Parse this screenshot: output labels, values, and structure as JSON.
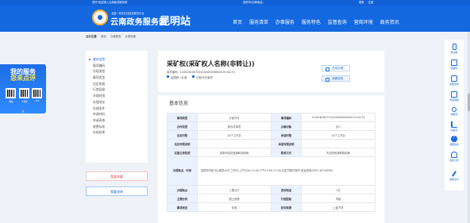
{
  "topbar": {
    "left": "您好!欢迎进入云南政务服务网",
    "center": "昆明市(切换地区)",
    "login": "登录",
    "register": "注册"
  },
  "header": {
    "subtitle": "全国一体化在线政务服务平台",
    "site_name": "云南政务服务网",
    "city": "昆明站",
    "nav": [
      "首页",
      "服务清单",
      "办事服务",
      "服务特色",
      "监督查询",
      "营商环境",
      "政务资讯"
    ]
  },
  "breadcrumb": {
    "label": "当前位置:",
    "items": [
      "首页",
      "办事服务",
      "办事指南"
    ]
  },
  "promo": {
    "line1": "我的服务",
    "line2": "您来点评",
    "qr_labels": [
      "网站",
      "小程序",
      "APP"
    ],
    "close": "×"
  },
  "left_menu": {
    "items": [
      "基本信息",
      "事项编码",
      "办理流程",
      "事项类型",
      "设定依据",
      "行使层级",
      "办理时限",
      "办理地址",
      "办理条件",
      "申请材料",
      "申请表格",
      "收费标准",
      "办结结果"
    ],
    "active_index": 0,
    "favorite_label": "我要收藏",
    "consult_label": "我要咨询"
  },
  "item": {
    "title": "采矿权(采矿权人名称(非转让))",
    "code_label": "事项编码:",
    "code": "11001620073201000000000015114174",
    "tags": [
      "全国统一办事",
      "行政许可事项"
    ],
    "btn_apply": "在线办理",
    "btn_guide": "我要咨询"
  },
  "section": {
    "title": "基本信息"
  },
  "table": {
    "rows": [
      [
        {
          "k": "事项类型",
          "v": "行政许可"
        },
        {
          "k": "事项编码",
          "v": "11001620073201000000000015114174"
        }
      ],
      [
        {
          "k": "办件类型",
          "v": "即办件事项"
        },
        {
          "k": "办事对象",
          "v": "法人"
        }
      ],
      [
        {
          "k": "法定时限",
          "v": "20个工作日"
        },
        {
          "k": "承诺时限",
          "v": "10个工作日"
        }
      ],
      [
        {
          "k": "法定时限说明",
          "v": ""
        },
        {
          "k": "承诺时限说明",
          "v": ""
        }
      ],
      [
        {
          "k": "实施主体性质",
          "v": "昆明市自然资源和规划局"
        },
        {
          "k": "联系方式",
          "v": "市自然资源和规划局"
        }
      ],
      [
        {
          "k": "办理地点、时间",
          "v": "昆明市市民中心服务大厅,工作日:上午9:00-12:00,下午13:00-17:00,法定节假日除外;电话咨询:0871-63148901"
        }
      ],
      [
        {
          "k": "办理地点",
          "v": "三楼大厅"
        },
        {
          "k": "咨询电话",
          "v": "1次"
        }
      ],
      [
        {
          "k": "主题分类",
          "v": "国土资源"
        },
        {
          "k": "行使层级",
          "v": "市级"
        }
      ],
      [
        {
          "k": "事项状态",
          "v": "在用"
        },
        {
          "k": "权利来源",
          "v": "上级下放"
        }
      ]
    ]
  },
  "rail": {
    "items": [
      "移动端",
      "我要问",
      "我要咨询",
      "智能客服",
      "我要找",
      "好差评",
      "我要投诉",
      "我的订阅",
      "我要点评"
    ]
  }
}
